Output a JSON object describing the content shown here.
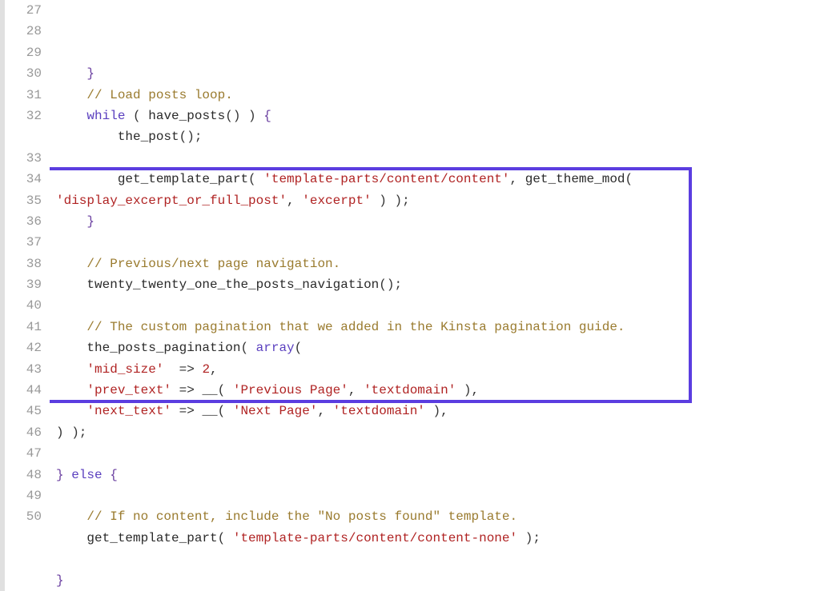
{
  "highlight": {
    "start_line_index": 7,
    "end_line_index": 17
  },
  "lines": [
    {
      "n": 27,
      "tokens": [
        {
          "cls": "plain",
          "t": "    "
        },
        {
          "cls": "brace",
          "t": "}"
        },
        {
          "cls": "plain",
          "t": ""
        }
      ]
    },
    {
      "n": 28,
      "tokens": [
        {
          "cls": "plain",
          "t": "    "
        },
        {
          "cls": "comment",
          "t": "// Load posts loop."
        }
      ]
    },
    {
      "n": 29,
      "tokens": [
        {
          "cls": "plain",
          "t": "    "
        },
        {
          "cls": "kw",
          "t": "while"
        },
        {
          "cls": "plain",
          "t": " ( "
        },
        {
          "cls": "fn",
          "t": "have_posts"
        },
        {
          "cls": "plain",
          "t": "() ) "
        },
        {
          "cls": "brace",
          "t": "{"
        }
      ]
    },
    {
      "n": 30,
      "tokens": [
        {
          "cls": "plain",
          "t": "        "
        },
        {
          "cls": "fn",
          "t": "the_post"
        },
        {
          "cls": "plain",
          "t": "();"
        }
      ]
    },
    {
      "n": 31,
      "tokens": []
    },
    {
      "n": 32,
      "tokens": [
        {
          "cls": "plain",
          "t": "        "
        },
        {
          "cls": "fn",
          "t": "get_template_part"
        },
        {
          "cls": "plain",
          "t": "( "
        },
        {
          "cls": "str",
          "t": "'template-parts/content/content'"
        },
        {
          "cls": "plain",
          "t": ", "
        },
        {
          "cls": "fn",
          "t": "get_theme_mod"
        },
        {
          "cls": "plain",
          "t": "( "
        },
        {
          "cls": "str",
          "t": "'display_excerpt_or_full_post'"
        },
        {
          "cls": "plain",
          "t": ", "
        },
        {
          "cls": "str",
          "t": "'excerpt'"
        },
        {
          "cls": "plain",
          "t": " ) );"
        }
      ],
      "wrap": true
    },
    {
      "n": 33,
      "tokens": [
        {
          "cls": "plain",
          "t": "    "
        },
        {
          "cls": "brace",
          "t": "}"
        }
      ]
    },
    {
      "n": 34,
      "tokens": []
    },
    {
      "n": 35,
      "tokens": [
        {
          "cls": "plain",
          "t": "    "
        },
        {
          "cls": "comment",
          "t": "// Previous/next page navigation."
        }
      ]
    },
    {
      "n": 36,
      "tokens": [
        {
          "cls": "plain",
          "t": "    "
        },
        {
          "cls": "fn",
          "t": "twenty_twenty_one_the_posts_navigation"
        },
        {
          "cls": "plain",
          "t": "();"
        }
      ]
    },
    {
      "n": 37,
      "tokens": []
    },
    {
      "n": 38,
      "tokens": [
        {
          "cls": "plain",
          "t": "    "
        },
        {
          "cls": "comment",
          "t": "// The custom pagination that we added in the Kinsta pagination guide."
        }
      ]
    },
    {
      "n": 39,
      "tokens": [
        {
          "cls": "plain",
          "t": "    "
        },
        {
          "cls": "fn",
          "t": "the_posts_pagination"
        },
        {
          "cls": "plain",
          "t": "( "
        },
        {
          "cls": "kw",
          "t": "array"
        },
        {
          "cls": "plain",
          "t": "("
        }
      ]
    },
    {
      "n": 40,
      "tokens": [
        {
          "cls": "plain",
          "t": "    "
        },
        {
          "cls": "str",
          "t": "'mid_size'"
        },
        {
          "cls": "plain",
          "t": "  => "
        },
        {
          "cls": "num",
          "t": "2"
        },
        {
          "cls": "plain",
          "t": ","
        }
      ]
    },
    {
      "n": 41,
      "tokens": [
        {
          "cls": "plain",
          "t": "    "
        },
        {
          "cls": "str",
          "t": "'prev_text'"
        },
        {
          "cls": "plain",
          "t": " => "
        },
        {
          "cls": "fn",
          "t": "__"
        },
        {
          "cls": "plain",
          "t": "( "
        },
        {
          "cls": "str",
          "t": "'Previous Page'"
        },
        {
          "cls": "plain",
          "t": ", "
        },
        {
          "cls": "str",
          "t": "'textdomain'"
        },
        {
          "cls": "plain",
          "t": " ),"
        }
      ]
    },
    {
      "n": 42,
      "tokens": [
        {
          "cls": "plain",
          "t": "    "
        },
        {
          "cls": "str",
          "t": "'next_text'"
        },
        {
          "cls": "plain",
          "t": " => "
        },
        {
          "cls": "fn",
          "t": "__"
        },
        {
          "cls": "plain",
          "t": "( "
        },
        {
          "cls": "str",
          "t": "'Next Page'"
        },
        {
          "cls": "plain",
          "t": ", "
        },
        {
          "cls": "str",
          "t": "'textdomain'"
        },
        {
          "cls": "plain",
          "t": " ),"
        }
      ]
    },
    {
      "n": 43,
      "tokens": [
        {
          "cls": "plain",
          "t": ") );"
        }
      ]
    },
    {
      "n": 44,
      "tokens": []
    },
    {
      "n": 45,
      "tokens": [
        {
          "cls": "brace",
          "t": "}"
        },
        {
          "cls": "plain",
          "t": " "
        },
        {
          "cls": "kw",
          "t": "else"
        },
        {
          "cls": "plain",
          "t": " "
        },
        {
          "cls": "brace",
          "t": "{"
        }
      ]
    },
    {
      "n": 46,
      "tokens": []
    },
    {
      "n": 47,
      "tokens": [
        {
          "cls": "plain",
          "t": "    "
        },
        {
          "cls": "comment",
          "t": "// If no content, include the \"No posts found\" template."
        }
      ]
    },
    {
      "n": 48,
      "tokens": [
        {
          "cls": "plain",
          "t": "    "
        },
        {
          "cls": "fn",
          "t": "get_template_part"
        },
        {
          "cls": "plain",
          "t": "( "
        },
        {
          "cls": "str",
          "t": "'template-parts/content/content-none'"
        },
        {
          "cls": "plain",
          "t": " );"
        }
      ]
    },
    {
      "n": 49,
      "tokens": []
    },
    {
      "n": 50,
      "tokens": [
        {
          "cls": "brace",
          "t": "}"
        }
      ]
    }
  ]
}
